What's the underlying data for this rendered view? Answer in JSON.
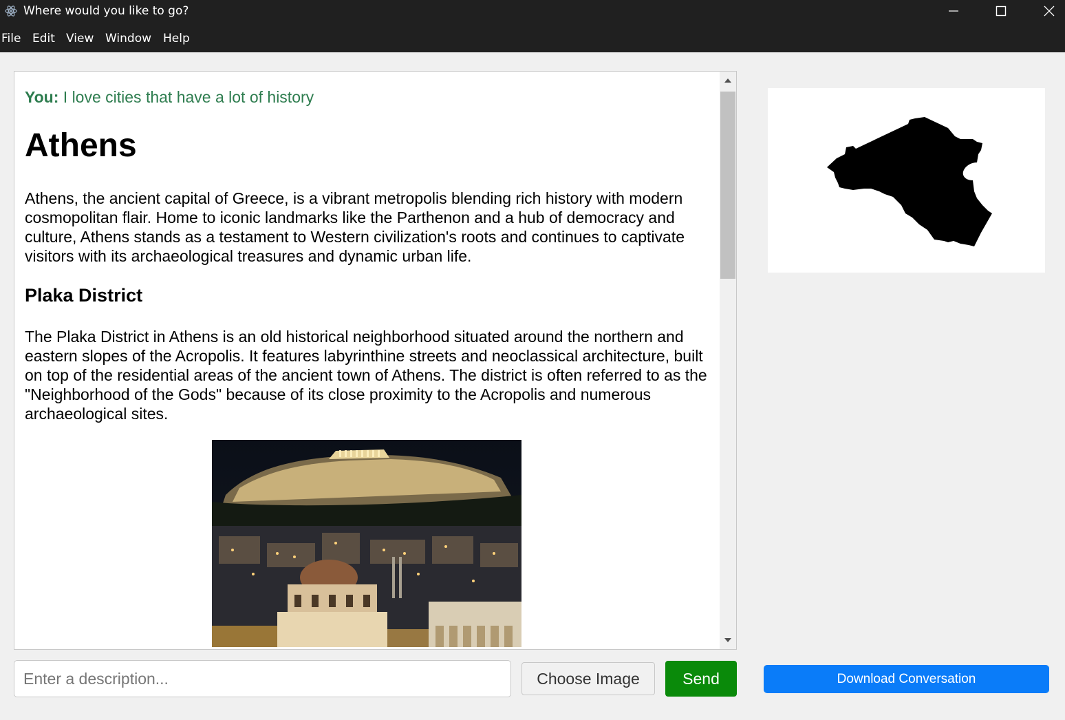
{
  "window": {
    "title": "Where would you like to go?",
    "icons": {
      "app": "electron-atom-icon",
      "minimize": "minimize-icon",
      "maximize": "maximize-icon",
      "close": "close-icon"
    }
  },
  "menu": {
    "file": "File",
    "edit": "Edit",
    "view": "View",
    "window": "Window",
    "help": "Help"
  },
  "chat": {
    "user_label": "You:",
    "user_message": "I love cities that have a lot of history",
    "city_name": "Athens",
    "city_description": "Athens, the ancient capital of Greece, is a vibrant metropolis blending rich history with modern cosmopolitan flair. Home to iconic landmarks like the Parthenon and a hub of democracy and culture, Athens stands as a testament to Western civilization's roots and continues to captivate visitors with its archaeological treasures and dynamic urban life.",
    "district_name": "Plaka District",
    "district_description": "The Plaka District in Athens is an old historical neighborhood situated around the northern and eastern slopes of the Acropolis. It features labyrinthine streets and neoclassical architecture, built on top of the residential areas of the ancient town of Athens. The district is often referred to as the \"Neighborhood of the Gods\" because of its close proximity to the Acropolis and numerous archaeological sites."
  },
  "colors": {
    "user_text": "#2e7d4f",
    "send": "#0a8a0a",
    "download": "#0a7cf9",
    "titlebar": "#202020"
  },
  "controls": {
    "description_placeholder": "Enter a description...",
    "choose_image": "Choose Image",
    "send": "Send",
    "download": "Download Conversation"
  }
}
